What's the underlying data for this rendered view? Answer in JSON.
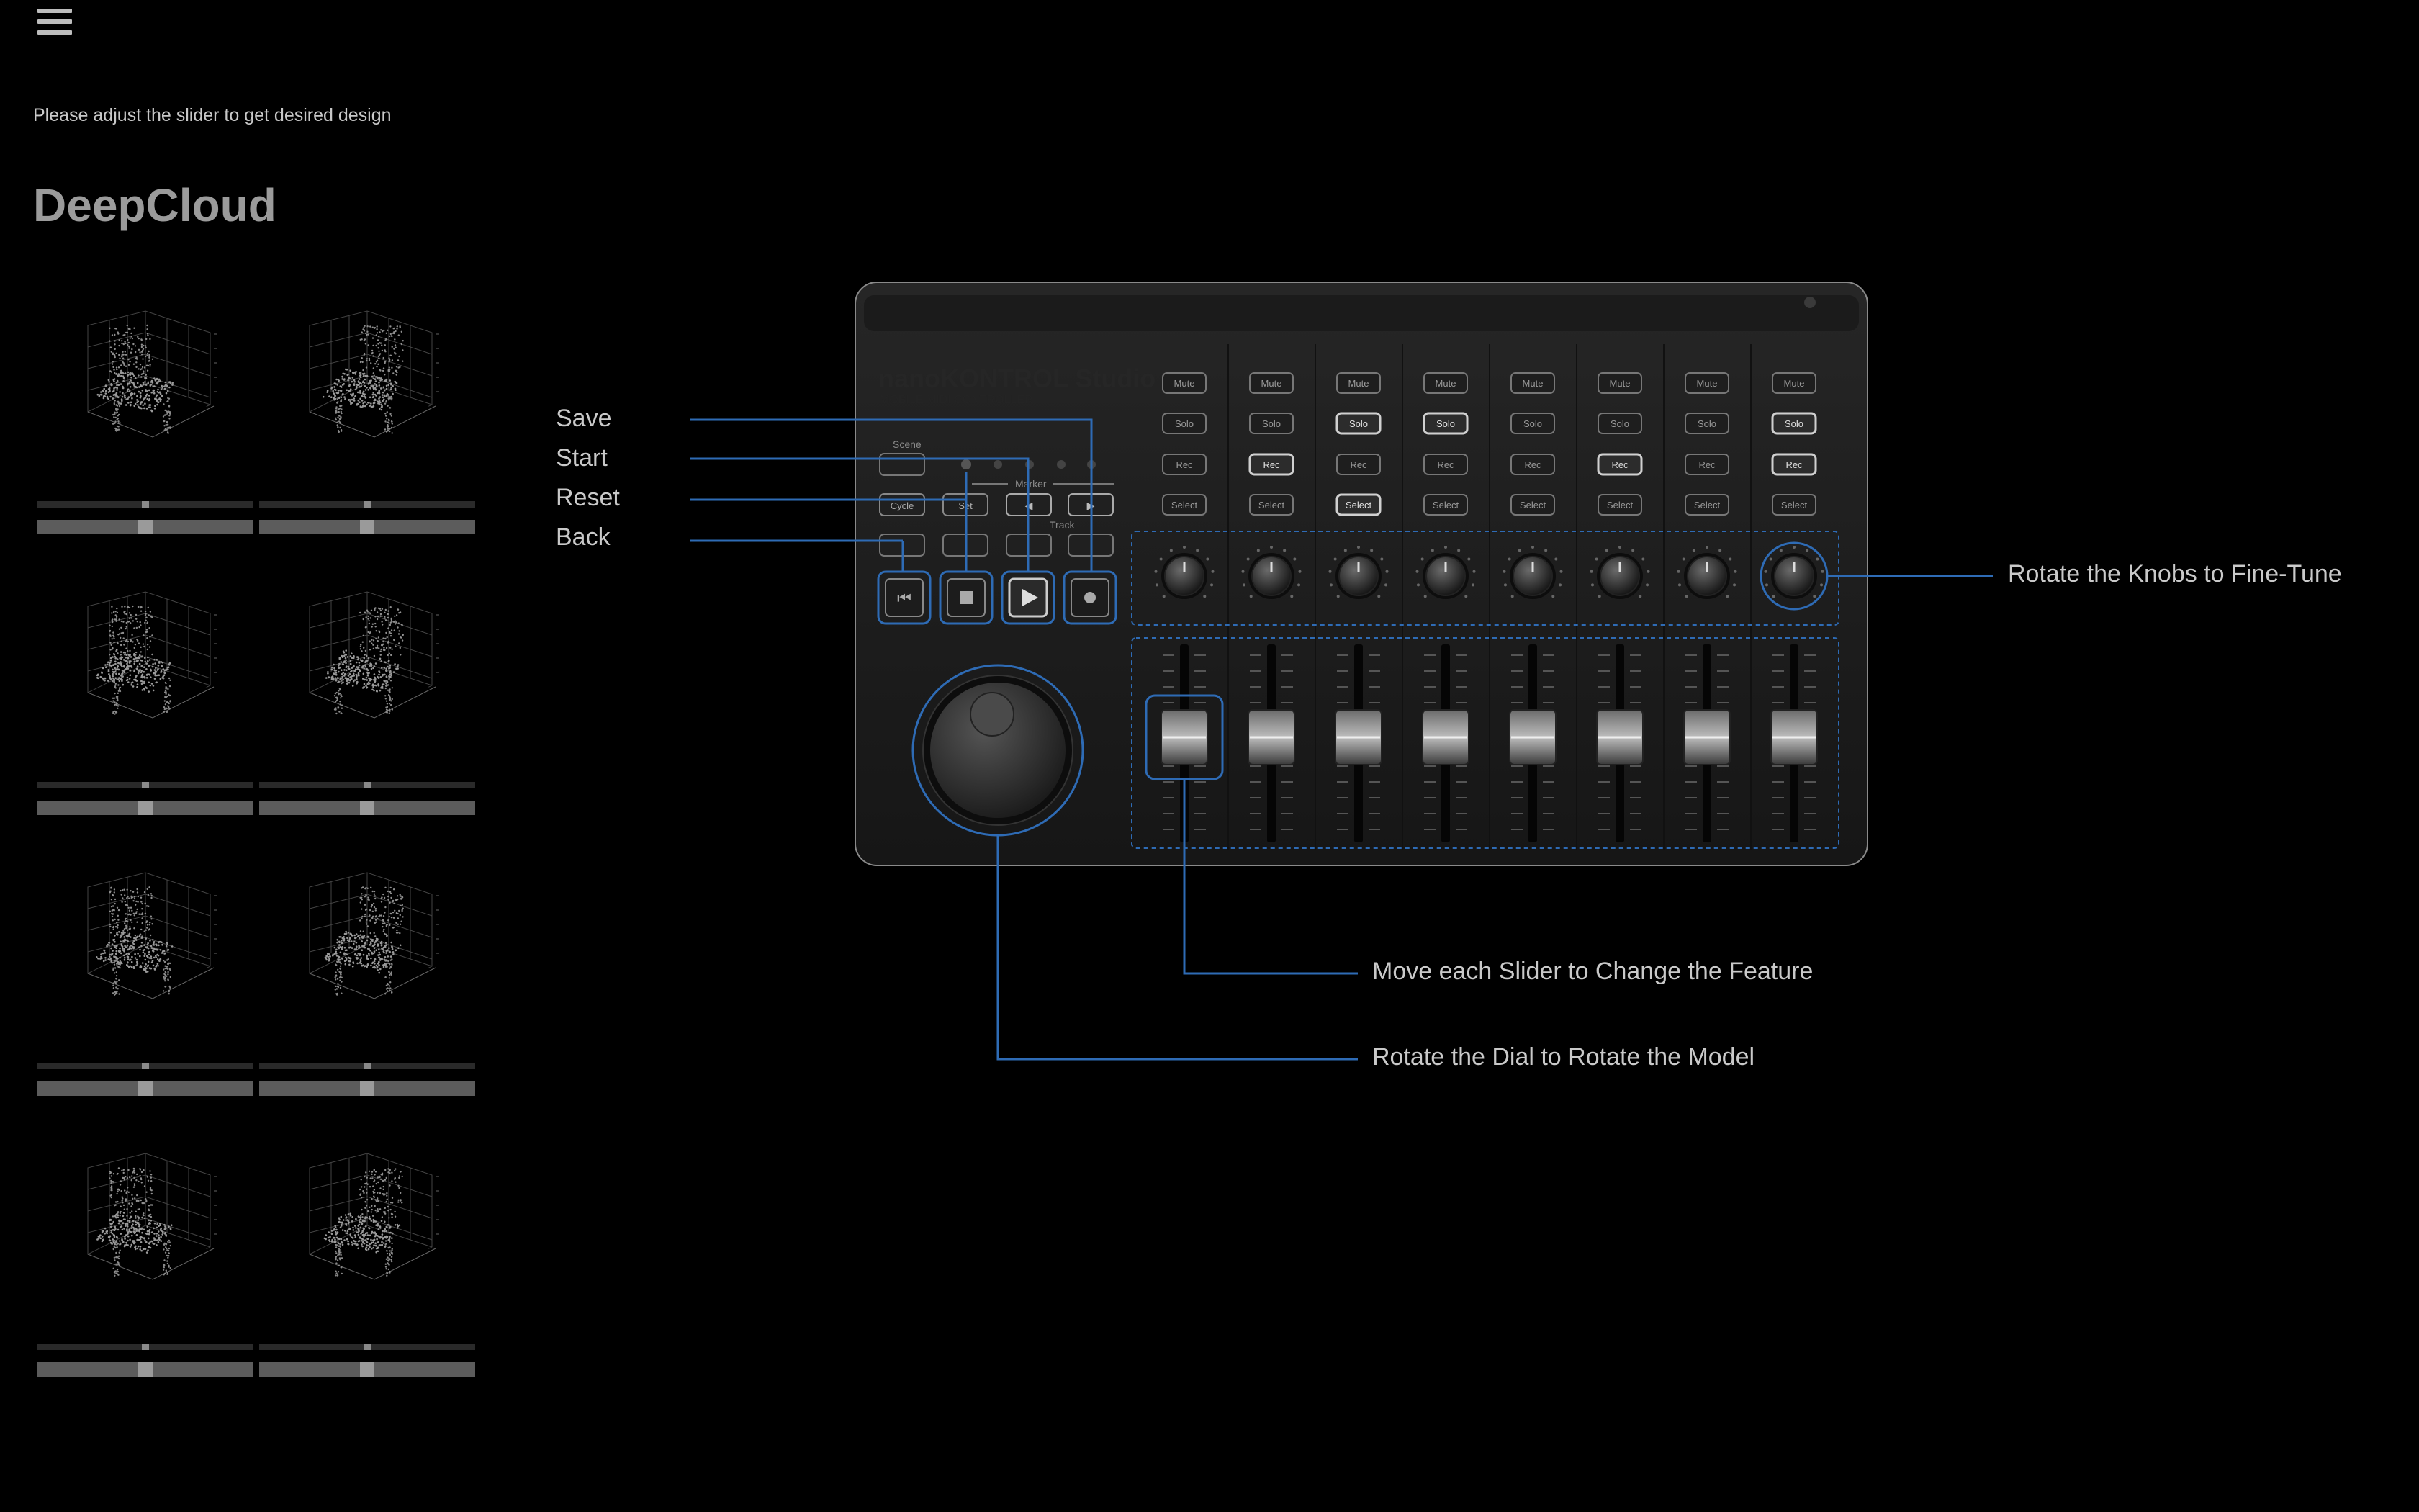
{
  "header": {
    "menu_icon": "hamburger-icon"
  },
  "instruction": "Please adjust the slider to get desired design",
  "app_title": "DeepCloud",
  "thumbnails": [
    {
      "mini": 0.5,
      "big": 0.5
    },
    {
      "mini": 0.5,
      "big": 0.5
    },
    {
      "mini": 0.5,
      "big": 0.5
    },
    {
      "mini": 0.5,
      "big": 0.5
    },
    {
      "mini": 0.5,
      "big": 0.5
    },
    {
      "mini": 0.5,
      "big": 0.5
    },
    {
      "mini": 0.5,
      "big": 0.5
    },
    {
      "mini": 0.5,
      "big": 0.5
    }
  ],
  "callouts": {
    "save": "Save",
    "start": "Start",
    "reset": "Reset",
    "back": "Back",
    "knobs": "Rotate the Knobs to Fine-Tune",
    "sliders": "Move each Slider to Change the Feature",
    "dial": "Rotate the Dial to Rotate the Model"
  },
  "controller": {
    "brand": "nanoKONTROL Studio",
    "subtitle": "MOBILE MIDI CONTROLLER",
    "scene_label": "Scene",
    "marker_label": "Marker",
    "track_label": "Track",
    "cycle_label": "Cycle",
    "set_label": "Set",
    "channels": [
      {
        "mute": "Mute",
        "solo": "Solo",
        "rec": "Rec",
        "select": "Select"
      },
      {
        "mute": "Mute",
        "solo": "Solo",
        "rec": "Rec",
        "select": "Select"
      },
      {
        "mute": "Mute",
        "solo": "Solo",
        "rec": "Rec",
        "select": "Select"
      },
      {
        "mute": "Mute",
        "solo": "Solo",
        "rec": "Rec",
        "select": "Select"
      },
      {
        "mute": "Mute",
        "solo": "Solo",
        "rec": "Rec",
        "select": "Select"
      },
      {
        "mute": "Mute",
        "solo": "Solo",
        "rec": "Rec",
        "select": "Select"
      },
      {
        "mute": "Mute",
        "solo": "Solo",
        "rec": "Rec",
        "select": "Select"
      },
      {
        "mute": "Mute",
        "solo": "Solo",
        "rec": "Rec",
        "select": "Select"
      }
    ],
    "transport_icons": [
      "skip-back-icon",
      "stop-icon",
      "play-icon",
      "record-icon"
    ],
    "accent_color": "#2e6bb5"
  }
}
